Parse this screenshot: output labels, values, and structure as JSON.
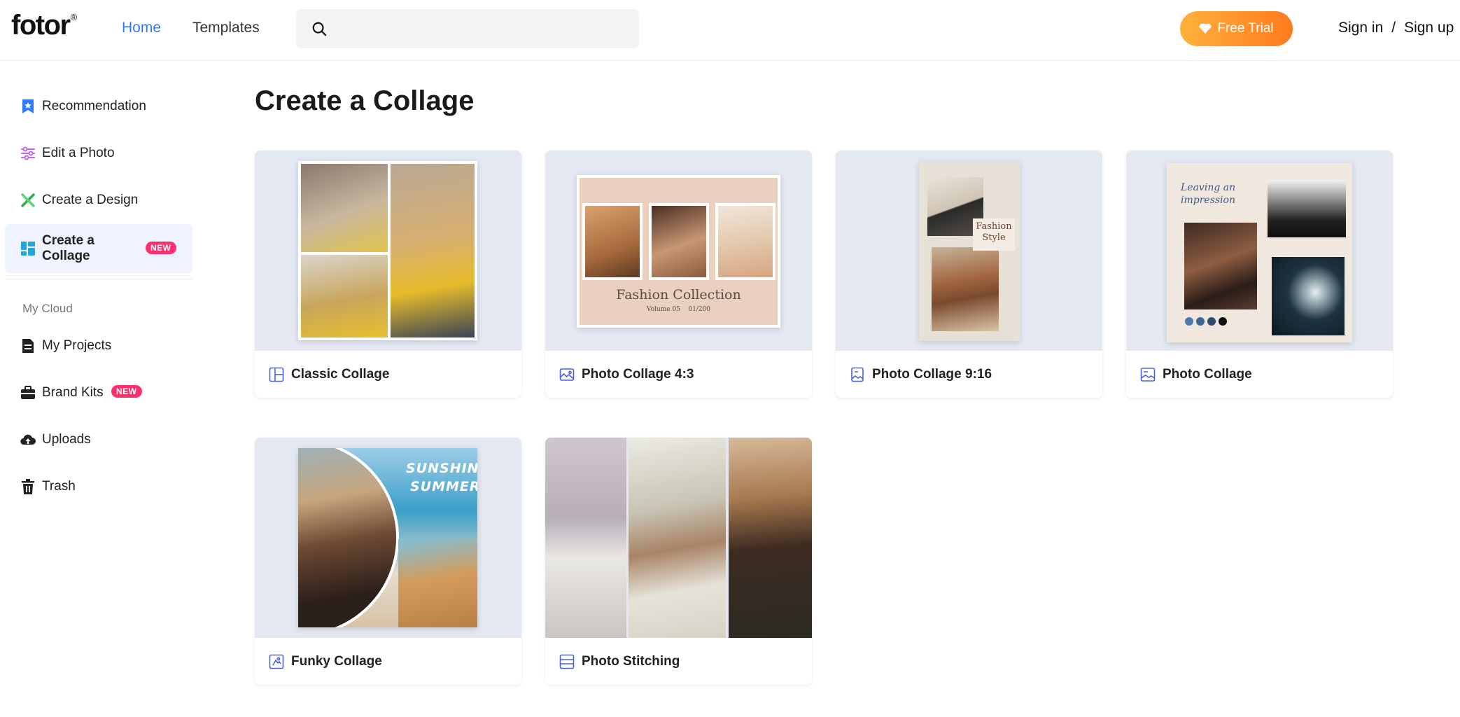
{
  "header": {
    "logo": "fotor",
    "logo_mark": "®",
    "nav": [
      {
        "label": "Home",
        "active": true
      },
      {
        "label": "Templates",
        "active": false
      }
    ],
    "search_placeholder": "",
    "trial_label": "Free Trial",
    "sign_in": "Sign in",
    "separator": "/",
    "sign_up": "Sign up"
  },
  "sidebar": {
    "items": [
      {
        "label": "Recommendation",
        "icon": "bookmark-star-icon"
      },
      {
        "label": "Edit a Photo",
        "icon": "sliders-icon"
      },
      {
        "label": "Create a Design",
        "icon": "design-tools-icon"
      },
      {
        "label": "Create a Collage",
        "icon": "collage-grid-icon",
        "badge": "NEW",
        "active": true
      }
    ],
    "section_label": "My Cloud",
    "cloud_items": [
      {
        "label": "My Projects",
        "icon": "document-icon"
      },
      {
        "label": "Brand Kits",
        "icon": "briefcase-icon",
        "badge": "NEW"
      },
      {
        "label": "Uploads",
        "icon": "cloud-upload-icon"
      },
      {
        "label": "Trash",
        "icon": "trash-icon"
      }
    ]
  },
  "main": {
    "title": "Create a Collage",
    "cards": [
      {
        "label": "Classic Collage",
        "icon": "layout-grid-icon"
      },
      {
        "label": "Photo Collage 4:3",
        "icon": "image-landscape-icon"
      },
      {
        "label": "Photo Collage 9:16",
        "icon": "image-portrait-icon"
      },
      {
        "label": "Photo Collage",
        "icon": "image-square-icon"
      },
      {
        "label": "Funky Collage",
        "icon": "funky-layout-icon"
      },
      {
        "label": "Photo Stitching",
        "icon": "stitch-rows-icon"
      }
    ],
    "thumb_text": {
      "fashion_collection": "Fashion Collection",
      "volume": "Volume 05    01/200",
      "fashion_style_1": "Fashion",
      "fashion_style_2": "Style",
      "leaving_1": "Leaving an",
      "leaving_2": "impression",
      "sunshine": "SUNSHINE",
      "summer": "SUMMER"
    }
  },
  "colors": {
    "accent": "#2f7bf6",
    "badge": "#ff2f6d",
    "trial_start": "#ffb13c",
    "trial_end": "#ff7a1e",
    "active_bg": "#eef3ff"
  }
}
